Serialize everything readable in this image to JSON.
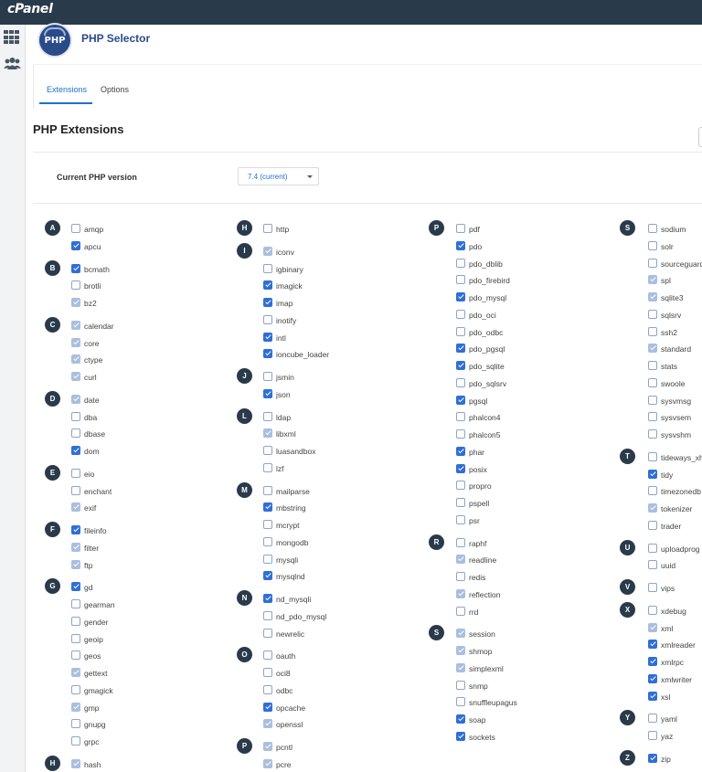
{
  "brand": "cPanel",
  "app": {
    "logo_text": "PHP",
    "title": "PHP Selector"
  },
  "tabs": [
    {
      "label": "Extensions",
      "active": true
    },
    {
      "label": "Options",
      "active": false
    }
  ],
  "section_title": "PHP Extensions",
  "version": {
    "label": "Current PHP version",
    "value": "7.4 (current)"
  },
  "colors": {
    "topbar": "#293a4a",
    "accent": "#1f6fd1",
    "checked": "#2f6fd6",
    "locked": "#a9bfdf"
  },
  "columns": [
    {
      "groups": [
        {
          "letter": "A",
          "items": [
            {
              "name": "amqp",
              "state": "off"
            },
            {
              "name": "apcu",
              "state": "on"
            }
          ]
        },
        {
          "letter": "B",
          "items": [
            {
              "name": "bcmath",
              "state": "on"
            },
            {
              "name": "brotli",
              "state": "off"
            },
            {
              "name": "bz2",
              "state": "disabled"
            }
          ]
        },
        {
          "letter": "C",
          "items": [
            {
              "name": "calendar",
              "state": "disabled"
            },
            {
              "name": "core",
              "state": "disabled"
            },
            {
              "name": "ctype",
              "state": "disabled"
            },
            {
              "name": "curl",
              "state": "disabled"
            }
          ]
        },
        {
          "letter": "D",
          "items": [
            {
              "name": "date",
              "state": "disabled"
            },
            {
              "name": "dba",
              "state": "off"
            },
            {
              "name": "dbase",
              "state": "off"
            },
            {
              "name": "dom",
              "state": "on"
            }
          ]
        },
        {
          "letter": "E",
          "items": [
            {
              "name": "eio",
              "state": "off"
            },
            {
              "name": "enchant",
              "state": "off"
            },
            {
              "name": "exif",
              "state": "disabled"
            }
          ]
        },
        {
          "letter": "F",
          "items": [
            {
              "name": "fileinfo",
              "state": "on"
            },
            {
              "name": "filter",
              "state": "disabled"
            },
            {
              "name": "ftp",
              "state": "disabled"
            }
          ]
        },
        {
          "letter": "G",
          "items": [
            {
              "name": "gd",
              "state": "on"
            },
            {
              "name": "gearman",
              "state": "off"
            },
            {
              "name": "gender",
              "state": "off"
            },
            {
              "name": "geoip",
              "state": "off"
            },
            {
              "name": "geos",
              "state": "off"
            },
            {
              "name": "gettext",
              "state": "disabled"
            },
            {
              "name": "gmagick",
              "state": "off"
            },
            {
              "name": "gmp",
              "state": "disabled"
            },
            {
              "name": "gnupg",
              "state": "off"
            },
            {
              "name": "grpc",
              "state": "off"
            }
          ]
        },
        {
          "letter": "H",
          "items": [
            {
              "name": "hash",
              "state": "disabled"
            }
          ]
        }
      ]
    },
    {
      "groups": [
        {
          "letter": "H",
          "items": [
            {
              "name": "http",
              "state": "off"
            }
          ]
        },
        {
          "letter": "I",
          "items": [
            {
              "name": "iconv",
              "state": "disabled"
            },
            {
              "name": "igbinary",
              "state": "off"
            },
            {
              "name": "imagick",
              "state": "on"
            },
            {
              "name": "imap",
              "state": "on"
            },
            {
              "name": "inotify",
              "state": "off"
            },
            {
              "name": "intl",
              "state": "on"
            },
            {
              "name": "ioncube_loader",
              "state": "on"
            }
          ]
        },
        {
          "letter": "J",
          "items": [
            {
              "name": "jsmin",
              "state": "off"
            },
            {
              "name": "json",
              "state": "on"
            }
          ]
        },
        {
          "letter": "L",
          "items": [
            {
              "name": "ldap",
              "state": "off"
            },
            {
              "name": "libxml",
              "state": "disabled"
            },
            {
              "name": "luasandbox",
              "state": "off"
            },
            {
              "name": "lzf",
              "state": "off"
            }
          ]
        },
        {
          "letter": "M",
          "items": [
            {
              "name": "mailparse",
              "state": "off"
            },
            {
              "name": "mbstring",
              "state": "on"
            },
            {
              "name": "mcrypt",
              "state": "off"
            },
            {
              "name": "mongodb",
              "state": "off"
            },
            {
              "name": "mysqli",
              "state": "off"
            },
            {
              "name": "mysqlnd",
              "state": "on"
            }
          ]
        },
        {
          "letter": "N",
          "items": [
            {
              "name": "nd_mysqli",
              "state": "on"
            },
            {
              "name": "nd_pdo_mysql",
              "state": "off"
            },
            {
              "name": "newrelic",
              "state": "off"
            }
          ]
        },
        {
          "letter": "O",
          "items": [
            {
              "name": "oauth",
              "state": "off"
            },
            {
              "name": "oci8",
              "state": "off"
            },
            {
              "name": "odbc",
              "state": "off"
            },
            {
              "name": "opcache",
              "state": "on"
            },
            {
              "name": "openssl",
              "state": "disabled"
            }
          ]
        },
        {
          "letter": "P",
          "items": [
            {
              "name": "pcntl",
              "state": "disabled"
            },
            {
              "name": "pcre",
              "state": "disabled"
            }
          ]
        }
      ]
    },
    {
      "groups": [
        {
          "letter": "P",
          "items": [
            {
              "name": "pdf",
              "state": "off"
            },
            {
              "name": "pdo",
              "state": "on"
            },
            {
              "name": "pdo_dblib",
              "state": "off"
            },
            {
              "name": "pdo_firebird",
              "state": "off"
            },
            {
              "name": "pdo_mysql",
              "state": "on"
            },
            {
              "name": "pdo_oci",
              "state": "off"
            },
            {
              "name": "pdo_odbc",
              "state": "off"
            },
            {
              "name": "pdo_pgsql",
              "state": "on"
            },
            {
              "name": "pdo_sqlite",
              "state": "on"
            },
            {
              "name": "pdo_sqlsrv",
              "state": "off"
            },
            {
              "name": "pgsql",
              "state": "on"
            },
            {
              "name": "phalcon4",
              "state": "off"
            },
            {
              "name": "phalcon5",
              "state": "off"
            },
            {
              "name": "phar",
              "state": "on"
            },
            {
              "name": "posix",
              "state": "on"
            },
            {
              "name": "propro",
              "state": "off"
            },
            {
              "name": "pspell",
              "state": "off"
            },
            {
              "name": "psr",
              "state": "off"
            }
          ]
        },
        {
          "letter": "R",
          "items": [
            {
              "name": "raphf",
              "state": "off"
            },
            {
              "name": "readline",
              "state": "disabled"
            },
            {
              "name": "redis",
              "state": "off"
            },
            {
              "name": "reflection",
              "state": "disabled"
            },
            {
              "name": "rrd",
              "state": "off"
            }
          ]
        },
        {
          "letter": "S",
          "items": [
            {
              "name": "session",
              "state": "disabled"
            },
            {
              "name": "shmop",
              "state": "disabled"
            },
            {
              "name": "simplexml",
              "state": "disabled"
            },
            {
              "name": "snmp",
              "state": "off"
            },
            {
              "name": "snuffleupagus",
              "state": "off"
            },
            {
              "name": "soap",
              "state": "on"
            },
            {
              "name": "sockets",
              "state": "on"
            }
          ]
        }
      ]
    },
    {
      "groups": [
        {
          "letter": "S",
          "items": [
            {
              "name": "sodium",
              "state": "off"
            },
            {
              "name": "solr",
              "state": "off"
            },
            {
              "name": "sourceguard",
              "state": "off"
            },
            {
              "name": "spl",
              "state": "disabled"
            },
            {
              "name": "sqlite3",
              "state": "disabled"
            },
            {
              "name": "sqlsrv",
              "state": "off"
            },
            {
              "name": "ssh2",
              "state": "off"
            },
            {
              "name": "standard",
              "state": "disabled"
            },
            {
              "name": "stats",
              "state": "off"
            },
            {
              "name": "swoole",
              "state": "off"
            },
            {
              "name": "sysvmsg",
              "state": "off"
            },
            {
              "name": "sysvsem",
              "state": "off"
            },
            {
              "name": "sysvshm",
              "state": "off"
            }
          ]
        },
        {
          "letter": "T",
          "items": [
            {
              "name": "tideways_xh",
              "state": "off"
            },
            {
              "name": "tidy",
              "state": "on"
            },
            {
              "name": "timezonedb",
              "state": "off"
            },
            {
              "name": "tokenizer",
              "state": "disabled"
            },
            {
              "name": "trader",
              "state": "off"
            }
          ]
        },
        {
          "letter": "U",
          "items": [
            {
              "name": "uploadprog",
              "state": "off"
            },
            {
              "name": "uuid",
              "state": "off"
            }
          ]
        },
        {
          "letter": "V",
          "items": [
            {
              "name": "vips",
              "state": "off"
            }
          ]
        },
        {
          "letter": "X",
          "items": [
            {
              "name": "xdebug",
              "state": "off"
            },
            {
              "name": "xml",
              "state": "disabled"
            },
            {
              "name": "xmlreader",
              "state": "on"
            },
            {
              "name": "xmlrpc",
              "state": "on"
            },
            {
              "name": "xmlwriter",
              "state": "on"
            },
            {
              "name": "xsl",
              "state": "on"
            }
          ]
        },
        {
          "letter": "Y",
          "items": [
            {
              "name": "yaml",
              "state": "off"
            },
            {
              "name": "yaz",
              "state": "off"
            }
          ]
        },
        {
          "letter": "Z",
          "items": [
            {
              "name": "zip",
              "state": "on"
            }
          ]
        }
      ]
    }
  ]
}
